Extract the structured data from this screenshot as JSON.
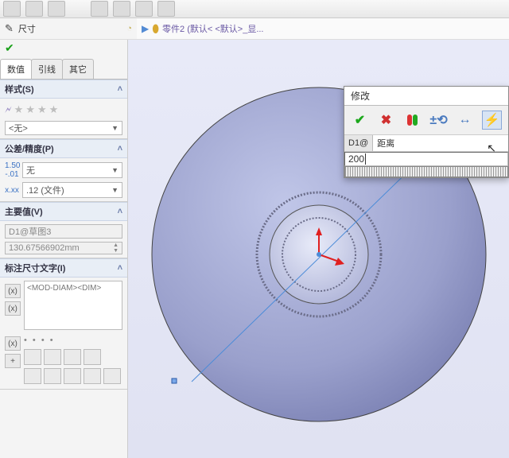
{
  "pm": {
    "title": "尺寸",
    "breadcrumb": "零件2 (默认< <默认>_显..."
  },
  "tabs": {
    "t0": "数值",
    "t1": "引线",
    "t2": "其它"
  },
  "style": {
    "header": "样式(S)",
    "select": "<无>"
  },
  "tol": {
    "header": "公差/精度(P)",
    "f1": "无",
    "f2": ".12 (文件)"
  },
  "main": {
    "header": "主要值(V)",
    "name": "D1@草图3",
    "value": "130.67566902mm"
  },
  "dimtext": {
    "header": "标注尺寸文字(I)",
    "content": "<MOD-DIAM><DIM>"
  },
  "modify": {
    "title": "修改",
    "label": "D1@",
    "field": "距离",
    "value": "200"
  }
}
